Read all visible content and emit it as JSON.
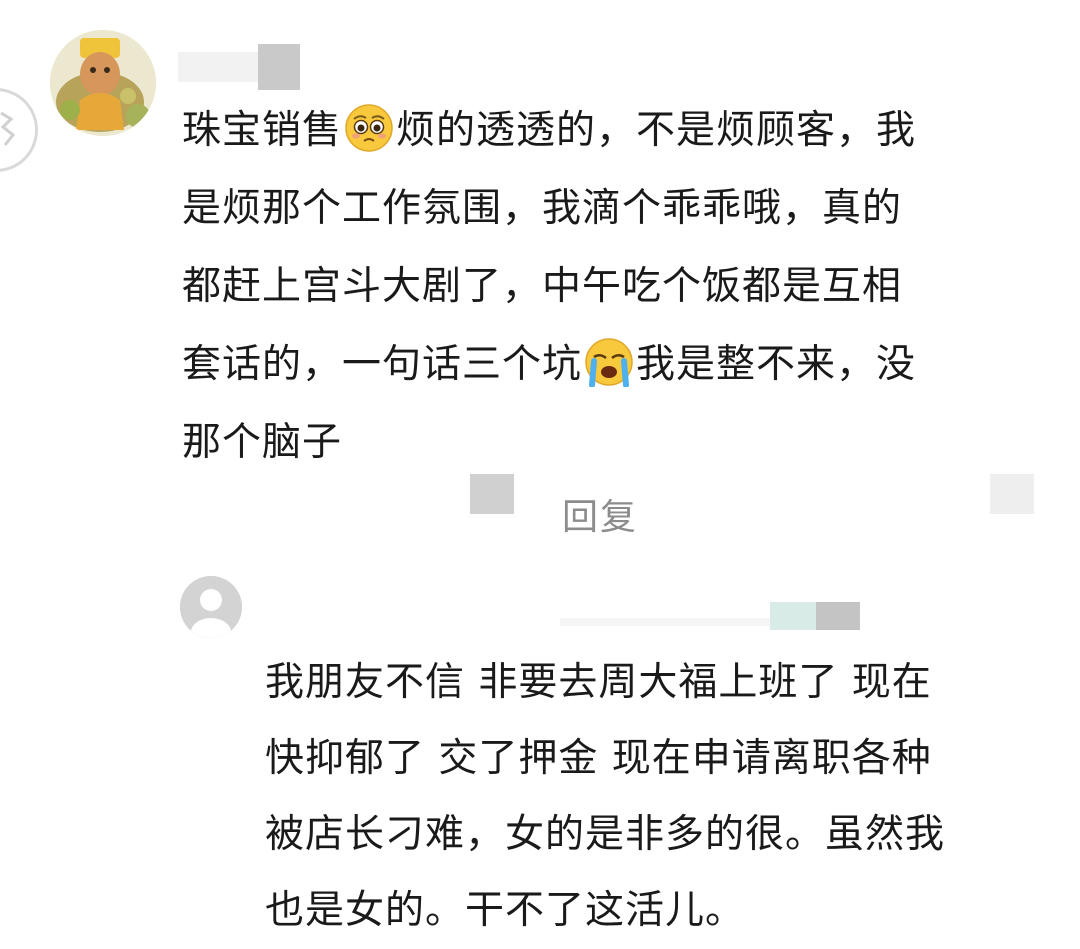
{
  "comment": {
    "segments": [
      "珠宝销售",
      "烦的透透的，不是烦顾客，我\n是烦那个工作氛围，我滴个乖乖哦，真的\n都赶上宫斗大剧了，中午吃个饭都是互相\n套话的，一句话三个坑",
      "我是整不来，没\n那个脑子"
    ],
    "emoji_1": "pleading-face-emoji",
    "emoji_2": "loudly-crying-face-emoji",
    "reply_label": "回复"
  },
  "reply": {
    "text": "我朋友不信 非要去周大福上班了 现在\n快抑郁了 交了押金 现在申请离职各种\n被店长刁难，女的是非多的很。虽然我\n也是女的。干不了这活儿。"
  },
  "colors": {
    "text": "#1a1a1a",
    "muted": "#8c8c8c",
    "background": "#ffffff",
    "default_avatar": "#d3d3d3"
  }
}
